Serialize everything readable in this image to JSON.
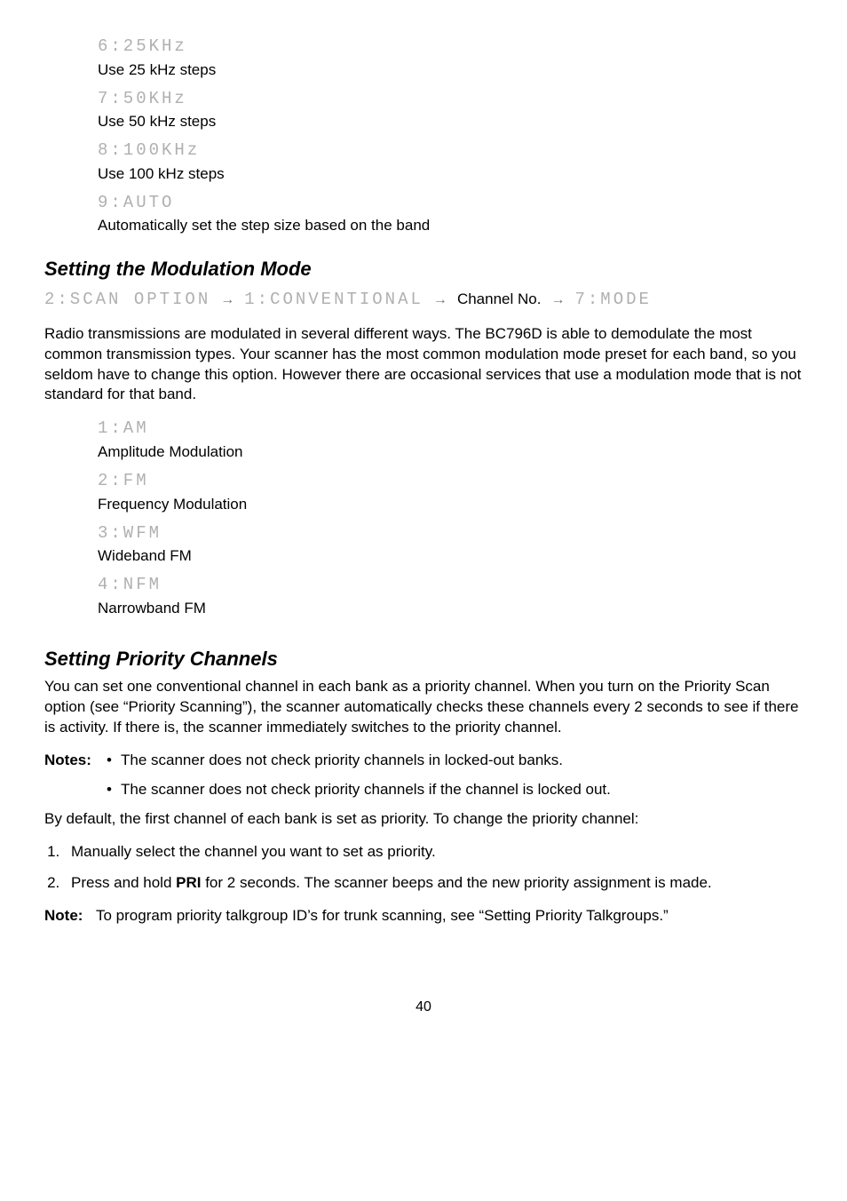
{
  "stepOptions": [
    {
      "code": "6:25KHz",
      "desc": "Use 25 kHz steps"
    },
    {
      "code": "7:50KHz",
      "desc": "Use 50 kHz steps"
    },
    {
      "code": "8:100KHz",
      "desc": "Use 100 kHz steps"
    },
    {
      "code": "9:AUTO",
      "desc": "Automatically set the step size based on the band"
    }
  ],
  "modulation": {
    "heading": "Setting the Modulation Mode",
    "path": {
      "p1": "2:SCAN OPTION",
      "p2": "1:CONVENTIONAL",
      "p3": "Channel No.",
      "p4": "7:MODE"
    },
    "body": "Radio transmissions are modulated in several different ways. The BC796D is able to demodulate the most common transmission types. Your scanner has the most common modulation mode preset for each band, so you seldom have to change this option. However there are occasional services that use a modulation mode that is not standard for that band.",
    "options": [
      {
        "code": "1:AM",
        "desc": "Amplitude Modulation"
      },
      {
        "code": "2:FM",
        "desc": "Frequency Modulation"
      },
      {
        "code": "3:WFM",
        "desc": "Wideband FM"
      },
      {
        "code": "4:NFM",
        "desc": "Narrowband FM"
      }
    ]
  },
  "priority": {
    "heading": "Setting Priority Channels",
    "body": "You can set one conventional channel in each bank as a priority channel. When you turn on the Priority Scan option (see “Priority Scanning”), the scanner automatically checks these channels every 2 seconds to see if there is activity. If there is, the scanner immediately switches to the priority channel.",
    "notesLabel": "Notes:",
    "notes": [
      "The scanner does not check priority channels in locked-out banks.",
      "The scanner does not check priority channels if the channel is locked out."
    ],
    "default": "By default, the first channel of each bank is set as priority. To change the priority channel:",
    "steps": [
      "Manually select the channel you want to set as priority.",
      "Press and hold PRI for 2 seconds. The scanner beeps and the new priority assignment is made."
    ],
    "step2_prefix": "Press and hold ",
    "step2_bold": "PRI",
    "step2_suffix": " for 2 seconds. The scanner beeps and the new priority assignment is made.",
    "noteLabel": "Note:",
    "note": "To program priority talkgroup ID’s for trunk scanning, see “Setting Priority Talkgroups.”"
  },
  "pageNumber": "40"
}
